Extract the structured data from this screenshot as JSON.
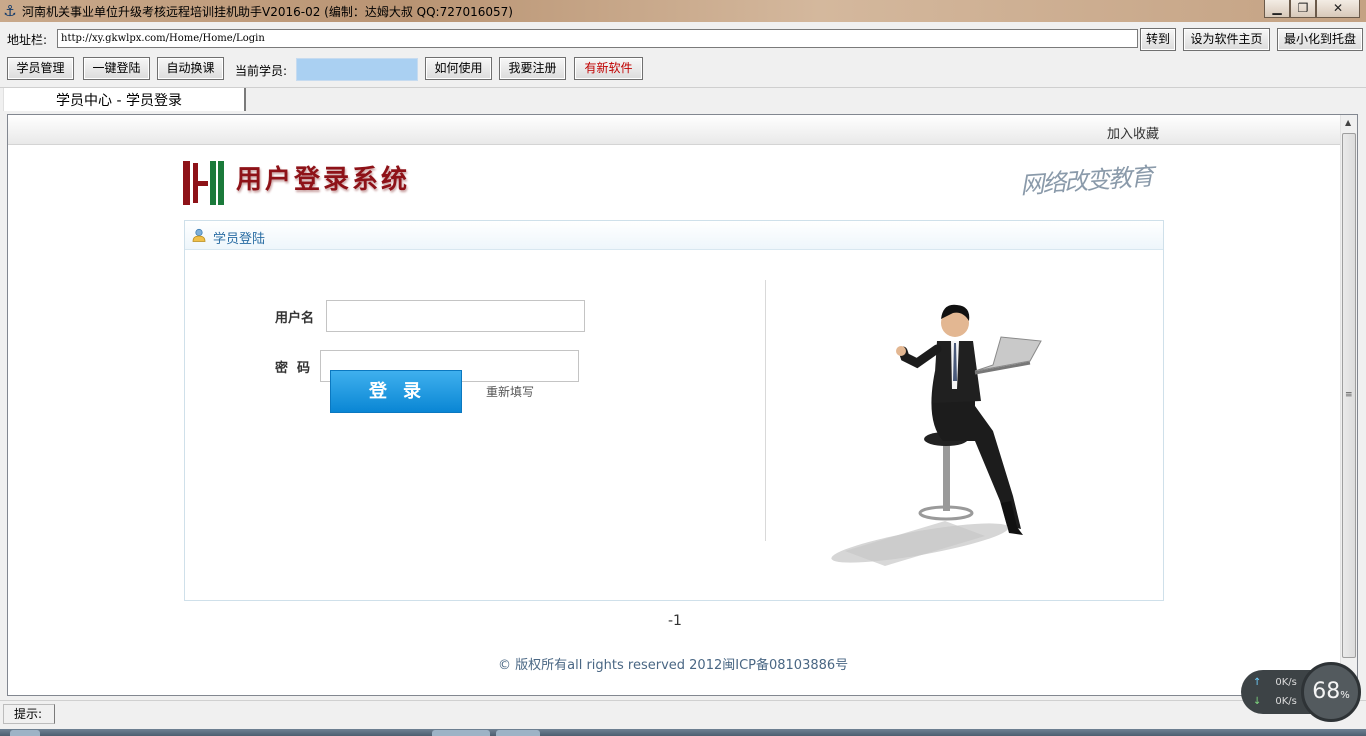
{
  "window": {
    "title": "河南机关事业单位升级考核远程培训挂机助手V2016-02 (编制：达姆大叔 QQ:727016057)",
    "min_label": "▁",
    "max_label": "❐",
    "close_label": "✕"
  },
  "address": {
    "label": "地址栏:",
    "url": "http://xy.gkwlpx.com/Home/Home/Login",
    "go_label": "转到",
    "set_home_label": "设为软件主页",
    "minimize_tray_label": "最小化到托盘"
  },
  "toolbar": {
    "member_manage": "学员管理",
    "one_key_login": "一键登陆",
    "auto_switch": "自动换课",
    "current_member_label": "当前学员:",
    "current_member_value": "",
    "how_to_use": "如何使用",
    "register": "我要注册",
    "new_software": "有新软件",
    "new_software_color": "#c00000"
  },
  "tab": {
    "label": "学员中心 - 学员登录"
  },
  "page": {
    "favorites_label": "加入收藏",
    "logo_text": "用户登录系统",
    "slogan": "网络改变教育",
    "panel_title": "学员登陆",
    "username_label": "用户名",
    "username_value": "",
    "password_label": "密  码",
    "password_value": "",
    "login_label": "登录",
    "reset_label": "重新填写",
    "page_number": "-1",
    "copyright": "© 版权所有all rights reserved 2012闽ICP备08103886号"
  },
  "status": {
    "hint_label": "提示:"
  },
  "speed_widget": {
    "up": "0K/s",
    "down": "0K/s",
    "percent": "68",
    "percent_unit": "%"
  },
  "colors": {
    "accent_blue": "#0a86d4",
    "logo_red": "#8e1218",
    "member_field": "#aad0f2"
  }
}
